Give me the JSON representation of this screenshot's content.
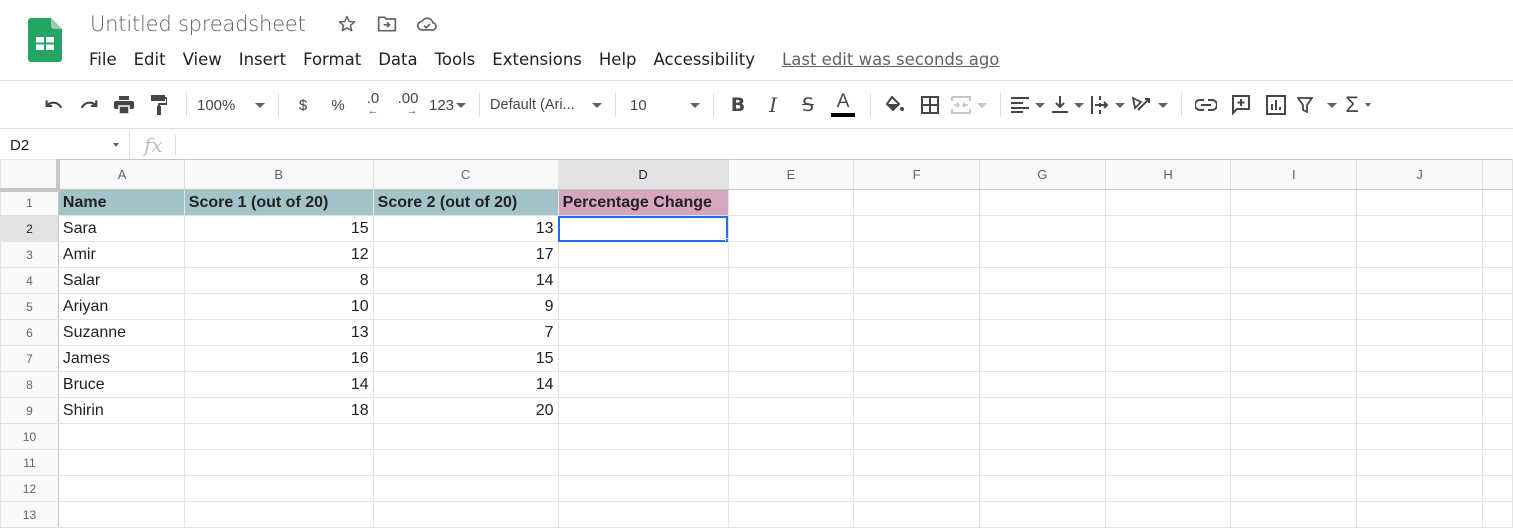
{
  "app": {
    "title": "Untitled spreadsheet",
    "title_icons": [
      "star-icon",
      "move-to-folder-icon",
      "cloud-saved-icon"
    ],
    "menu": [
      "File",
      "Edit",
      "View",
      "Insert",
      "Format",
      "Data",
      "Tools",
      "Extensions",
      "Help",
      "Accessibility"
    ],
    "last_edit": "Last edit was seconds ago",
    "brand_color": "#0f9d58"
  },
  "toolbar": {
    "zoom": "100%",
    "currency": "$",
    "percent": "%",
    "decrease_decimal": ".0",
    "increase_decimal": ".00",
    "more_formats": "123",
    "font": "Default (Ari...",
    "font_size": "10",
    "text_color": "#000000"
  },
  "formula_bar": {
    "cell_ref": "D2",
    "fx": "fx",
    "value": ""
  },
  "sheet": {
    "columns": [
      "A",
      "B",
      "C",
      "D",
      "E",
      "F",
      "G",
      "H",
      "I",
      "J"
    ],
    "selected_column": "D",
    "selected_row": 2,
    "active_cell": "D2",
    "header_colors": {
      "teal": "#a2c4c9",
      "pink": "#d5a6bd",
      "selection": "#1a73e8"
    },
    "rows": [
      [
        "Name",
        "Score 1 (out of 20)",
        "Score 2 (out of 20)",
        "Percentage Change"
      ],
      [
        "Sara",
        "15",
        "13",
        ""
      ],
      [
        "Amir",
        "12",
        "17",
        ""
      ],
      [
        "Salar",
        "8",
        "14",
        ""
      ],
      [
        "Ariyan",
        "10",
        "9",
        ""
      ],
      [
        "Suzanne",
        "13",
        "7",
        ""
      ],
      [
        "James",
        "16",
        "15",
        ""
      ],
      [
        "Bruce",
        "14",
        "14",
        ""
      ],
      [
        "Shirin",
        "18",
        "20",
        ""
      ],
      [
        "",
        "",
        "",
        ""
      ],
      [
        "",
        "",
        "",
        ""
      ],
      [
        "",
        "",
        "",
        ""
      ],
      [
        "",
        "",
        "",
        ""
      ]
    ]
  }
}
